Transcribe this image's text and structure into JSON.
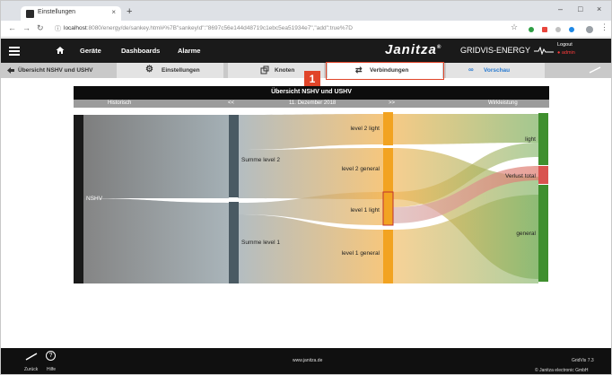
{
  "browser": {
    "tab_title": "Einstellungen",
    "tab_close": "×",
    "new_tab": "+",
    "win_min": "–",
    "win_max": "□",
    "win_close": "×",
    "url_host": "localhost",
    "url_rest": ":8080/energy/de/sankey.html#%7B\"sankeyId\":\"8697c56e144d48719c1ebc5ea51934e7\",\"add\":true%7D"
  },
  "header": {
    "nav": [
      "Geräte",
      "Dashboards",
      "Alarme"
    ],
    "brand": "Janitza",
    "brand_mark": "®",
    "product": "GRIDVIS-ENERGY",
    "logout": "Logout",
    "user": "admin"
  },
  "tabs": {
    "back": "Übersicht NSHV und USHV",
    "settings": "Einstellungen",
    "nodes": "Knoten",
    "connections": "Verbindungen",
    "preview": "Vorschau",
    "step_callout": "1"
  },
  "chart": {
    "title": "Übersicht NSHV und USHV",
    "left_label": "Historisch",
    "prev": "<<",
    "date": "11. Dezember 2018",
    "next": ">>",
    "unit": "Wirkleistung"
  },
  "chart_data": {
    "type": "sankey",
    "nodes": [
      "NSHV",
      "Summe level 2",
      "Summe level 1",
      "level 2 light",
      "level 2 general",
      "level 1 light",
      "level 1 general",
      "light",
      "Verlust total",
      "general"
    ],
    "links": [
      {
        "source": "NSHV",
        "target": "Summe level 2"
      },
      {
        "source": "NSHV",
        "target": "Summe level 1"
      },
      {
        "source": "Summe level 2",
        "target": "level 2 light"
      },
      {
        "source": "Summe level 2",
        "target": "level 2 general"
      },
      {
        "source": "Summe level 1",
        "target": "level 1 light"
      },
      {
        "source": "Summe level 1",
        "target": "level 1 general"
      },
      {
        "source": "level 2 light",
        "target": "light"
      },
      {
        "source": "level 1 light",
        "target": "light"
      },
      {
        "source": "level 2 general",
        "target": "general"
      },
      {
        "source": "level 1 general",
        "target": "general"
      },
      {
        "source": "level 1 light",
        "target": "Verlust total"
      }
    ]
  },
  "status": {
    "back": "Zurück",
    "help": "Hilfe",
    "site": "www.janitza.de",
    "version": "GridVis 7.3",
    "copyright": "© Janitza electronic GmbH"
  },
  "colors": {
    "accent": "#e0452a",
    "node_dark": "#1a1a1a",
    "node_slate": "#4a5a63",
    "node_orange": "#f2a321",
    "node_green": "#3f8f2e",
    "node_red": "#d9534f"
  },
  "icons": [
    "hamburger-icon",
    "home-icon",
    "back-arrow-icon",
    "gear-icon",
    "node-icon",
    "shuffle-icon",
    "glasses-icon",
    "help-icon"
  ]
}
